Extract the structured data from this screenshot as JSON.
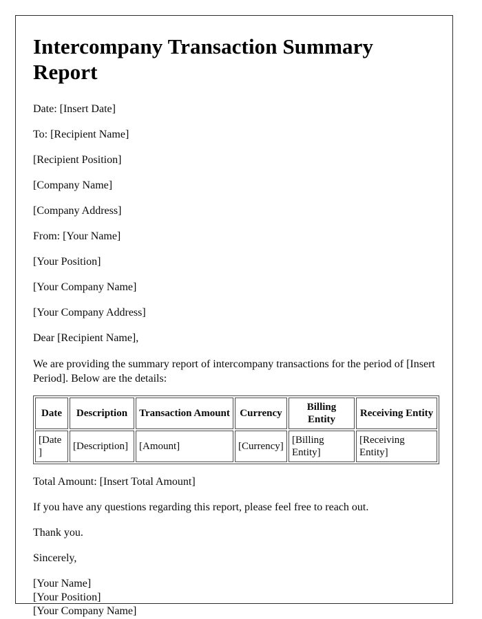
{
  "document": {
    "title": "Intercompany Transaction Summary Report",
    "date_line": "Date: [Insert Date]",
    "recipient": {
      "to_line": "To: [Recipient Name]",
      "position": "[Recipient Position]",
      "company_name": "[Company Name]",
      "company_address": "[Company Address]"
    },
    "sender": {
      "from_line": "From: [Your Name]",
      "position": "[Your Position]",
      "company_name": "[Your Company Name]",
      "company_address": "[Your Company Address]"
    },
    "salutation": "Dear [Recipient Name],",
    "intro_paragraph": "We are providing the summary report of intercompany transactions for the period of [Insert Period]. Below are the details:",
    "table": {
      "headers": [
        "Date",
        "Description",
        "Transaction Amount",
        "Currency",
        "Billing Entity",
        "Receiving Entity"
      ],
      "rows": [
        [
          "[Date]",
          "[Description]",
          "[Amount]",
          "[Currency]",
          "[Billing Entity]",
          "[Receiving Entity]"
        ]
      ]
    },
    "total_amount_line": "Total Amount: [Insert Total Amount]",
    "questions_line": "If you have any questions regarding this report, please feel free to reach out.",
    "thanks_line": "Thank you.",
    "closing": "Sincerely,",
    "signature": {
      "name": "[Your Name]",
      "position": "[Your Position]",
      "company_name": "[Your Company Name]"
    }
  },
  "colors": {
    "text": "#0a0a0a",
    "page_border": "#2b2b2b",
    "table_border": "#4a4a4a",
    "background": "#ffffff"
  }
}
